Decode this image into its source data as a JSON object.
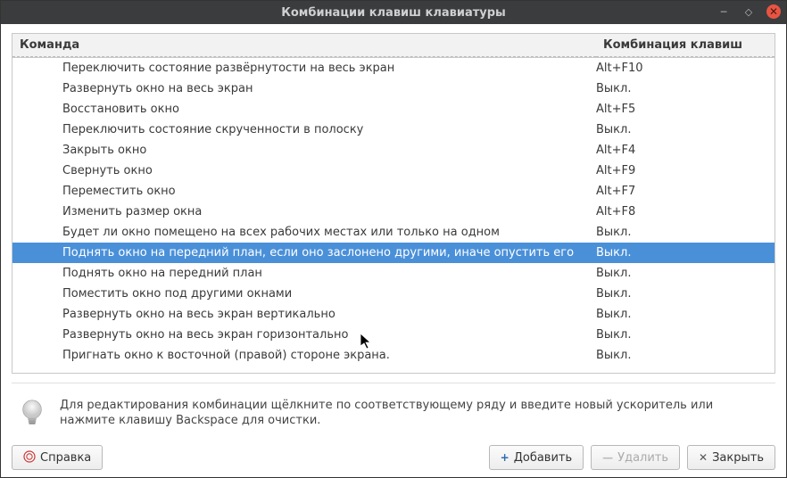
{
  "window": {
    "title": "Комбинации клавиш клавиатуры"
  },
  "table": {
    "header": {
      "command": "Команда",
      "shortcut": "Комбинация клавиш"
    },
    "rows": [
      {
        "cmd": "Переключить состояние развёрнутости на весь экран",
        "shortcut": "Alt+F10",
        "selected": false
      },
      {
        "cmd": "Развернуть окно на весь экран",
        "shortcut": "Выкл.",
        "selected": false
      },
      {
        "cmd": "Восстановить окно",
        "shortcut": "Alt+F5",
        "selected": false
      },
      {
        "cmd": "Переключить состояние скрученности в полоску",
        "shortcut": "Выкл.",
        "selected": false
      },
      {
        "cmd": "Закрыть окно",
        "shortcut": "Alt+F4",
        "selected": false
      },
      {
        "cmd": "Свернуть окно",
        "shortcut": "Alt+F9",
        "selected": false
      },
      {
        "cmd": "Переместить окно",
        "shortcut": "Alt+F7",
        "selected": false
      },
      {
        "cmd": "Изменить размер окна",
        "shortcut": "Alt+F8",
        "selected": false
      },
      {
        "cmd": "Будет ли окно помещено на всех рабочих местах или только на одном",
        "shortcut": "Выкл.",
        "selected": false
      },
      {
        "cmd": "Поднять окно на передний план, если оно заслонено другими, иначе опустить его",
        "shortcut": "Выкл.",
        "selected": true
      },
      {
        "cmd": "Поднять окно на передний план",
        "shortcut": "Выкл.",
        "selected": false
      },
      {
        "cmd": "Поместить окно под другими окнами",
        "shortcut": "Выкл.",
        "selected": false
      },
      {
        "cmd": "Развернуть окно на весь экран вертикально",
        "shortcut": "Выкл.",
        "selected": false
      },
      {
        "cmd": "Развернуть окно на весь экран горизонтально",
        "shortcut": "Выкл.",
        "selected": false
      },
      {
        "cmd": "Пригнать окно к восточной (правой) стороне экрана.",
        "shortcut": "Выкл.",
        "selected": false
      }
    ]
  },
  "hint": "Для редактирования комбинации щёлкните по соответствующему ряду и введите новый ускоритель или нажмите клавишу Backspace для очистки.",
  "buttons": {
    "help": "Справка",
    "add": "Добавить",
    "remove": "Удалить",
    "close": "Закрыть"
  },
  "icons": {
    "add": "+",
    "remove": "—",
    "close": "✕"
  }
}
